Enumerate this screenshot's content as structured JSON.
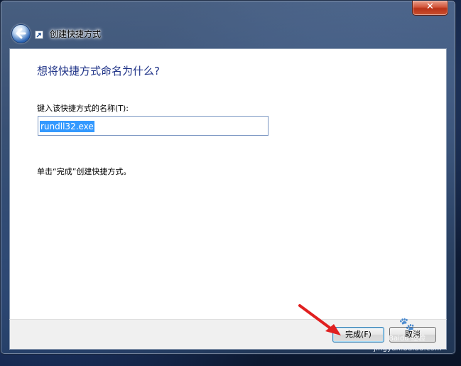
{
  "window": {
    "title": "创建快捷方式",
    "close_symbol": "✕"
  },
  "content": {
    "heading": "想将快捷方式命名为什么?",
    "field_label": "键入该快捷方式的名称(T):",
    "name_value": "rundll32.exe",
    "hint": "单击“完成”创建快捷方式。"
  },
  "buttons": {
    "finish": "完成(F)",
    "cancel": "取消"
  },
  "watermark": {
    "text": "Baidu 经验",
    "url": "jingyan.baidu.com"
  },
  "icons": {
    "back": "back-arrow-icon",
    "shortcut": "shortcut-arrow-icon",
    "close": "close-icon",
    "annotation": "red-arrow-annotation"
  },
  "colors": {
    "heading": "#1e3287",
    "selection": "#3399ff",
    "close_button": "#c9502f",
    "annotation_arrow": "#e02020"
  }
}
